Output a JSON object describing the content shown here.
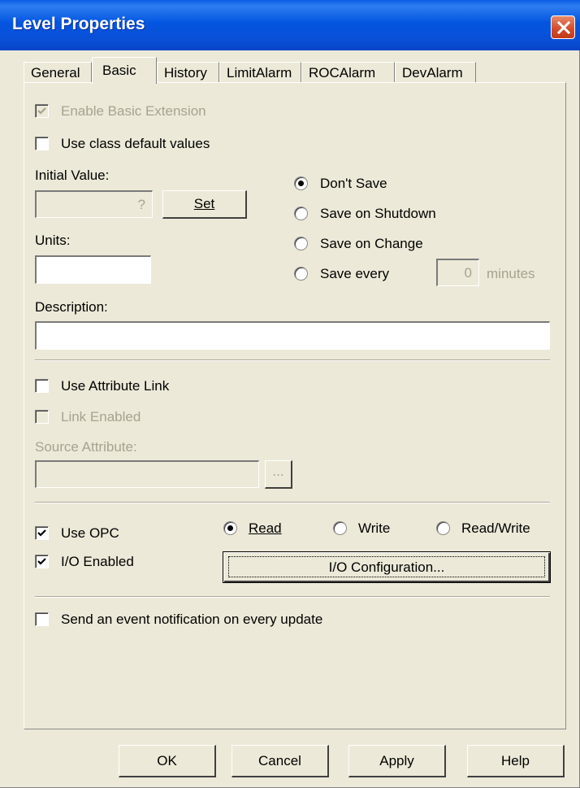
{
  "window": {
    "title": "Level Properties"
  },
  "tabs": [
    {
      "label": "General"
    },
    {
      "label": "Basic"
    },
    {
      "label": "History"
    },
    {
      "label": "LimitAlarm"
    },
    {
      "label": "ROCAlarm"
    },
    {
      "label": "DevAlarm"
    }
  ],
  "active_tab": "Basic",
  "basic": {
    "enable_basic_extension": {
      "label": "Enable Basic Extension",
      "checked": true,
      "enabled": false
    },
    "use_class_defaults": {
      "label": "Use class default values",
      "checked": false
    },
    "initial_value": {
      "label": "Initial Value:",
      "value": "?",
      "set_label": "Set"
    },
    "units": {
      "label": "Units:",
      "value": ""
    },
    "save_options": {
      "selected": "Don't Save",
      "options": [
        "Don't Save",
        "Save on Shutdown",
        "Save on Change",
        "Save every"
      ],
      "interval_value": "0",
      "interval_unit": "minutes"
    },
    "description": {
      "label": "Description:",
      "value": ""
    },
    "use_attribute_link": {
      "label": "Use Attribute Link",
      "checked": false
    },
    "link_enabled": {
      "label": "Link Enabled",
      "checked": false,
      "enabled": false
    },
    "source_attribute": {
      "label": "Source Attribute:",
      "value": "",
      "browse_label": "..."
    },
    "use_opc": {
      "label": "Use OPC",
      "checked": true
    },
    "io_enabled": {
      "label": "I/O Enabled",
      "checked": true
    },
    "opc_mode": {
      "selected": "Read",
      "options": [
        "Read",
        "Write",
        "Read/Write"
      ]
    },
    "io_config_label": "I/O Configuration...",
    "send_event": {
      "label": "Send an event notification on every update",
      "checked": false
    }
  },
  "footer": {
    "ok": "OK",
    "cancel": "Cancel",
    "apply": "Apply",
    "help": "Help"
  }
}
